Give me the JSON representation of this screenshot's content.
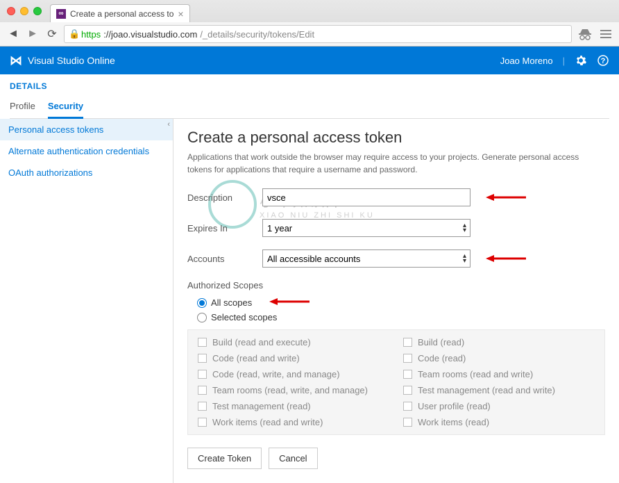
{
  "browser": {
    "tab_title": "Create a personal access to",
    "url_https": "https",
    "url_host": "://joao.visualstudio.com",
    "url_path": "/_details/security/tokens/Edit"
  },
  "header": {
    "brand": "Visual Studio Online",
    "user": "Joao Moreno"
  },
  "details": {
    "title": "DETAILS",
    "tabs": [
      "Profile",
      "Security"
    ]
  },
  "sidebar": {
    "items": [
      "Personal access tokens",
      "Alternate authentication credentials",
      "OAuth authorizations"
    ]
  },
  "page": {
    "heading": "Create a personal access token",
    "subtitle": "Applications that work outside the browser may require access to your projects. Generate personal access tokens for applications that require a username and password.",
    "labels": {
      "description": "Description",
      "expires": "Expires In",
      "accounts": "Accounts",
      "scopes_title": "Authorized Scopes",
      "all_scopes": "All scopes",
      "selected_scopes": "Selected scopes"
    },
    "values": {
      "description": "vsce",
      "expires": "1 year",
      "accounts": "All accessible accounts"
    },
    "scopes_left": [
      "Build (read and execute)",
      "Code (read and write)",
      "Code (read, write, and manage)",
      "Team rooms (read, write, and manage)",
      "Test management (read)",
      "Work items (read and write)"
    ],
    "scopes_right": [
      "Build (read)",
      "Code (read)",
      "Team rooms (read and write)",
      "Test management (read and write)",
      "User profile (read)",
      "Work items (read)"
    ],
    "buttons": {
      "create": "Create Token",
      "cancel": "Cancel"
    }
  },
  "watermark": {
    "main": "小牛知识库",
    "sub": "XIAO NIU ZHI SHI KU"
  }
}
